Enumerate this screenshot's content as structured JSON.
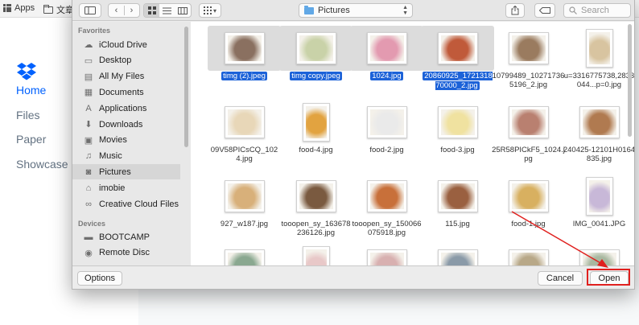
{
  "browser": {
    "bookmarks": [
      {
        "label": "Apps",
        "icon": "apps-grid-icon"
      },
      {
        "label": "文章",
        "icon": "folder-icon"
      }
    ]
  },
  "dropbox": {
    "nav": [
      "Home",
      "Files",
      "Paper",
      "Showcase"
    ],
    "accent": "#0061fe"
  },
  "dialog": {
    "toolbar": {
      "location": "Pictures",
      "search_placeholder": "Search"
    },
    "sidebar": {
      "favorites_header": "Favorites",
      "favorites": [
        {
          "label": "iCloud Drive",
          "icon": "cloud-icon"
        },
        {
          "label": "Desktop",
          "icon": "desktop-icon"
        },
        {
          "label": "All My Files",
          "icon": "all-files-icon"
        },
        {
          "label": "Documents",
          "icon": "documents-icon"
        },
        {
          "label": "Applications",
          "icon": "applications-icon"
        },
        {
          "label": "Downloads",
          "icon": "downloads-icon"
        },
        {
          "label": "Movies",
          "icon": "movies-icon"
        },
        {
          "label": "Music",
          "icon": "music-icon"
        },
        {
          "label": "Pictures",
          "icon": "camera-icon"
        },
        {
          "label": "imobie",
          "icon": "home-icon"
        },
        {
          "label": "Creative Cloud Files",
          "icon": "creative-cloud-icon"
        }
      ],
      "selected": "Pictures",
      "devices_header": "Devices",
      "devices": [
        {
          "label": "BOOTCAMP",
          "icon": "drive-icon"
        },
        {
          "label": "Remote Disc",
          "icon": "disc-icon"
        }
      ]
    },
    "files": [
      {
        "name": "timg (2).jpeg",
        "selected": true,
        "color": "#8a7060"
      },
      {
        "name": "timg copy.jpeg",
        "selected": true,
        "color": "#c9d2a8"
      },
      {
        "name": "1024.jpg",
        "selected": true,
        "color": "#e39ab0"
      },
      {
        "name": "20860925_172131870000_2.jpg",
        "selected": true,
        "color": "#c05a3a"
      },
      {
        "name": "10799489_102717365196_2.jpg",
        "selected": false,
        "color": "#9a7b5f"
      },
      {
        "name": "u=3316775738,2833044...p=0.jpg",
        "selected": false,
        "color": "#d8c4a0"
      },
      {
        "name": "09V58PICsCQ_1024.jpg",
        "selected": false,
        "color": "#e8d7b8"
      },
      {
        "name": "food-4.jpg",
        "selected": false,
        "color": "#e2a340"
      },
      {
        "name": "food-2.jpg",
        "selected": false,
        "color": "#eaeaea"
      },
      {
        "name": "food-3.jpg",
        "selected": false,
        "color": "#f0e2a0"
      },
      {
        "name": "25R58PICkF5_1024.jpg",
        "selected": false,
        "color": "#b98070"
      },
      {
        "name": "240425-12101H0164835.jpg",
        "selected": false,
        "color": "#b07a50"
      },
      {
        "name": "927_w187.jpg",
        "selected": false,
        "color": "#d8b07a"
      },
      {
        "name": "tooopen_sy_163678236126.jpg",
        "selected": false,
        "color": "#7a5a40"
      },
      {
        "name": "tooopen_sy_150066075918.jpg",
        "selected": false,
        "color": "#c8703a"
      },
      {
        "name": "115.jpg",
        "selected": false,
        "color": "#9a6040"
      },
      {
        "name": "food-1.jpg",
        "selected": false,
        "color": "#d8b060"
      },
      {
        "name": "IMG_0041.JPG",
        "selected": false,
        "color": "#c8b8d8"
      },
      {
        "name": "",
        "selected": false,
        "color": "#8aa890"
      },
      {
        "name": "",
        "selected": false,
        "color": "#e8c8c8"
      },
      {
        "name": "",
        "selected": false,
        "color": "#d8b0b0"
      },
      {
        "name": "",
        "selected": false,
        "color": "#8a9aa8"
      },
      {
        "name": "",
        "selected": false,
        "color": "#b8a888"
      },
      {
        "name": "",
        "selected": false,
        "color": "#a8b8a0"
      }
    ],
    "buttons": {
      "options": "Options",
      "cancel": "Cancel",
      "open": "Open"
    },
    "annotation_color": "#e0201e"
  }
}
